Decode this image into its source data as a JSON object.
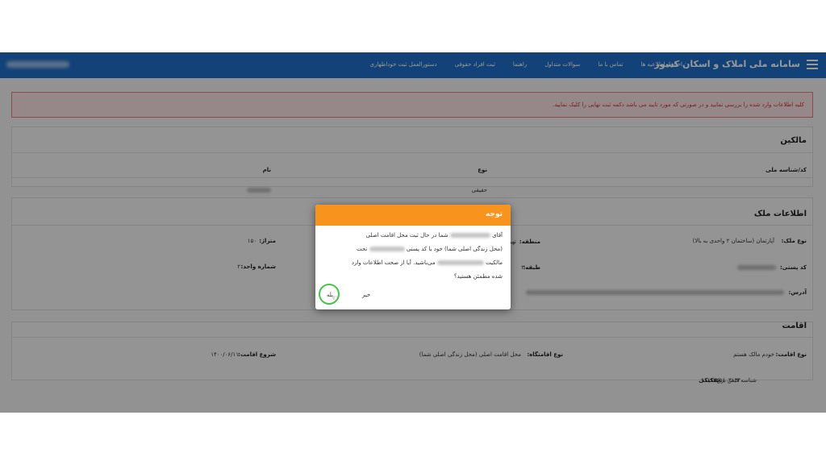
{
  "header": {
    "title": "سامانه ملی املاک و اسکان کشور",
    "nav": [
      "اخبار و اطلاعیه ها",
      "تماس با ما",
      "سوالات متداول",
      "راهنما",
      "ثبت افراد حقوقی",
      "دستورالعمل ثبت خوداظهاری"
    ]
  },
  "alert": {
    "text": "کلیه اطلاعات وارد شده را بررسی نمایید و در صورتی که مورد تایید می باشد دکمه ثبت نهایی را کلیک نمایید."
  },
  "owners": {
    "title": "مالکین",
    "col_national_id": "کد/شناسه ملی",
    "col_type": "نوع",
    "col_name": "نام",
    "type_value": "حقیقی"
  },
  "property": {
    "title": "اطلاعات ملک",
    "type_label": "نوع ملک:",
    "type_value": "آپارتمان (ساختمان ۲ واحدی به بالا)",
    "region_label": "منطقه:",
    "region_value": "تهر",
    "area_label": "متراژ:",
    "area_value": "۱۵۰",
    "postal_label": "کد پستی:",
    "floor_label": "طبقه:",
    "floor_value": "۲",
    "unit_label": "شماره واحد:",
    "unit_value": "۲",
    "address_label": "آدرس:"
  },
  "residence": {
    "title": "اقامت",
    "type_label": "نوع اقامت:",
    "type_value": "خودم مالک هستم",
    "place_label": "نوع اقامتگاه:",
    "place_value": "محل اقامت اصلی (محل زندگی اصلی شما)",
    "start_label": "شروع اقامت:",
    "start_value": "۱۴۰۰/۰۶/۱۱",
    "bill_id_label": "شناسه قبض برق:",
    "bill_id_value": "۹۱۶۹۳۲۵۶۰۳۱۳۴",
    "bill_label": "تفکیکی"
  },
  "modal": {
    "title": "توجه",
    "line1_a": "آقای",
    "line1_b": "شما در حال ثبت محل اقامت اصلی",
    "line2_a": "(محل زندگی اصلی شما) خود با کد پستی",
    "line2_b": "تحت",
    "line3_a": "مالکیت",
    "line3_b": "می‌باشید. آیا از صحت اطلاعات وارد",
    "line4": "شده مطمئن هستید؟",
    "yes": "بله",
    "no": "خیر"
  },
  "colors": {
    "header": "#1f6fc9",
    "modal_header": "#f7941d",
    "alert_border": "#e08080",
    "focus_ring": "#4cc24c"
  }
}
